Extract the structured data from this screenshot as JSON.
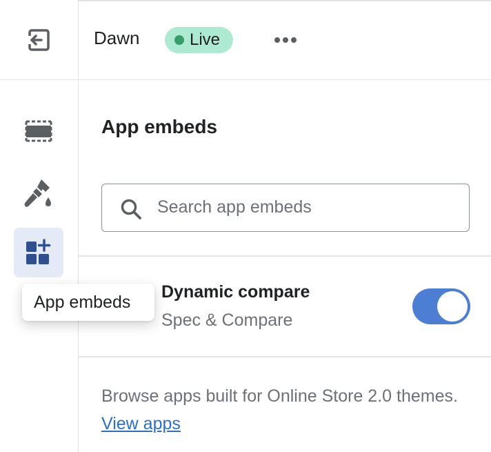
{
  "header": {
    "theme_name": "Dawn",
    "status_badge": "Live",
    "status_color": "#aee9d1"
  },
  "rail": {
    "items": [
      {
        "icon": "exit-icon"
      },
      {
        "icon": "sections-icon"
      },
      {
        "icon": "theme-settings-icon"
      },
      {
        "icon": "app-embeds-icon",
        "active": true
      }
    ],
    "tooltip": "App embeds"
  },
  "panel": {
    "title": "App embeds",
    "search_placeholder": "Search app embeds",
    "embeds": [
      {
        "name": "Dynamic compare",
        "app": "Spec & Compare",
        "enabled": true
      }
    ],
    "browse_text": "Browse apps built for Online Store 2.0 themes.",
    "browse_link": "View apps"
  },
  "colors": {
    "accent": "#4c7ed4",
    "link": "#2c6ecb",
    "active_nav_bg": "#e4ebf7"
  }
}
